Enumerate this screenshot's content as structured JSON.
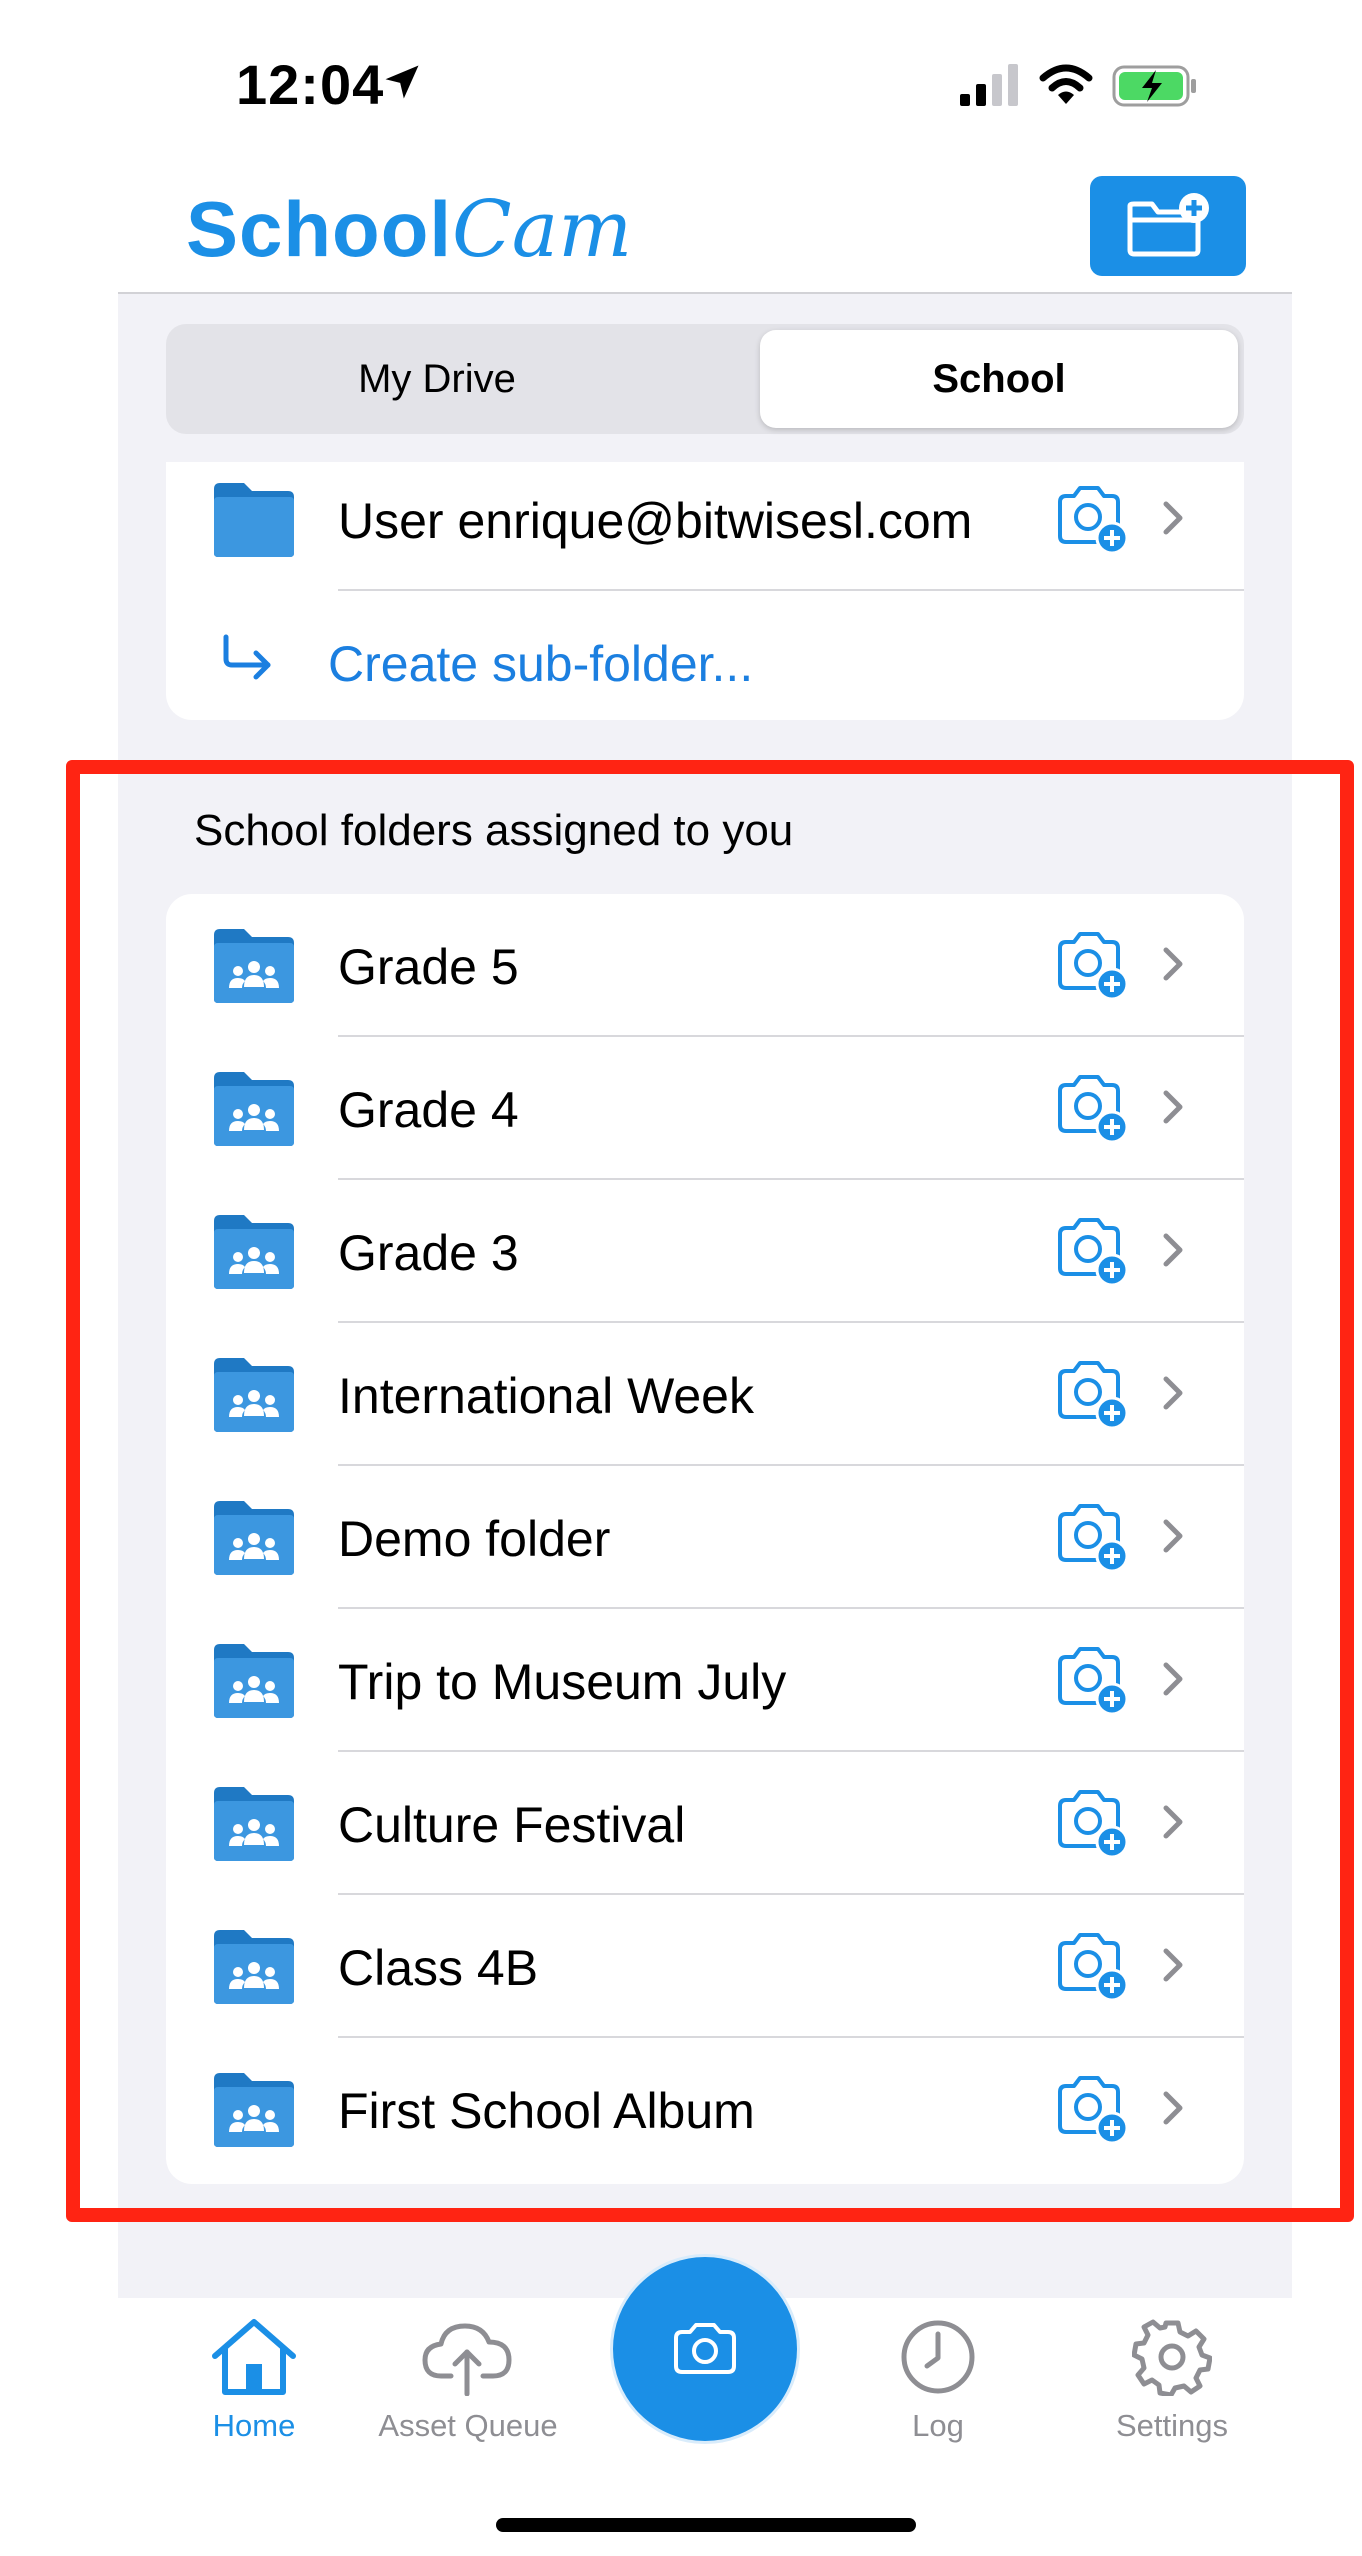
{
  "status_bar": {
    "time": "12:04",
    "icons": [
      "location-arrow-icon",
      "cellular-signal-icon",
      "wifi-icon",
      "battery-charging-icon"
    ]
  },
  "header": {
    "logo_part1": "School",
    "logo_part2": "Cam",
    "add_folder_icon": "folder-plus-icon"
  },
  "segmented": {
    "options": [
      "My Drive",
      "School"
    ],
    "selected": "School"
  },
  "top_list": {
    "user_folder": "User enrique@bitwisesl.com",
    "create_subfolder": "Create sub-folder..."
  },
  "section_title": "School folders assigned to you",
  "folders": [
    {
      "label": "Grade 5"
    },
    {
      "label": "Grade 4"
    },
    {
      "label": "Grade 3"
    },
    {
      "label": "International Week"
    },
    {
      "label": "Demo folder"
    },
    {
      "label": "Trip to Museum July"
    },
    {
      "label": "Culture Festival"
    },
    {
      "label": "Class 4B"
    },
    {
      "label": "First School Album"
    }
  ],
  "tabbar": {
    "tabs": [
      {
        "label": "Home",
        "icon": "home-icon",
        "active": true
      },
      {
        "label": "Asset Queue",
        "icon": "cloud-upload-icon",
        "active": false
      },
      {
        "label": "Log",
        "icon": "clock-icon",
        "active": false
      },
      {
        "label": "Settings",
        "icon": "gear-icon",
        "active": false
      }
    ],
    "center_button_icon": "camera-icon"
  },
  "colors": {
    "accent": "#1b8fe6",
    "link": "#1b7fe0",
    "highlight": "#ff2413",
    "background": "#f2f2f7"
  }
}
